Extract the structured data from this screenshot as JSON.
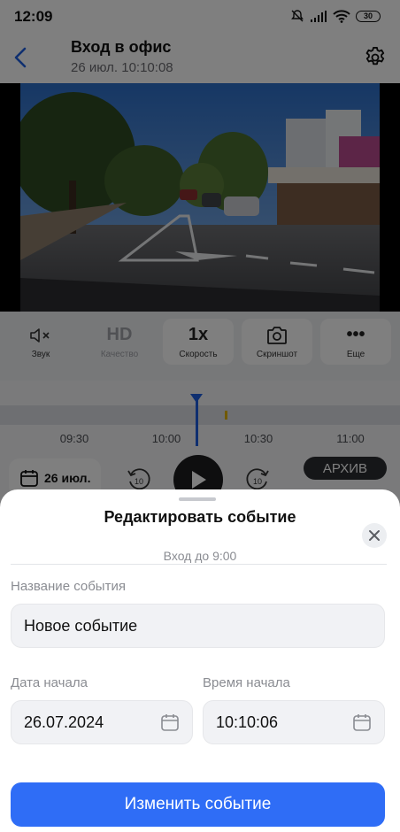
{
  "status_bar": {
    "time": "12:09",
    "battery": "30"
  },
  "header": {
    "title": "Вход в офис",
    "subtitle": "26 июл. 10:10:08"
  },
  "controls": [
    {
      "label": "Звук",
      "icon": "speaker-muted-icon"
    },
    {
      "label": "Качество",
      "icon_text": "HD"
    },
    {
      "label": "Скорость",
      "icon_text": "1x"
    },
    {
      "label": "Скриншот",
      "icon": "camera-icon"
    },
    {
      "label": "Еще",
      "icon_text": "•••"
    }
  ],
  "timeline": {
    "ticks": [
      "09:30",
      "10:00",
      "10:30",
      "11:00"
    ],
    "date_chip": "26 июл.",
    "skip_seconds": "10",
    "mode_badge": "АРХИВ"
  },
  "sheet": {
    "title": "Редактировать событие",
    "subtitle": "Вход до 9:00",
    "event_name_label": "Название события",
    "event_name_value": "Новое событие",
    "start_date_label": "Дата начала",
    "start_date_value": "26.07.2024",
    "start_time_label": "Время начала",
    "start_time_value": "10:10:06",
    "submit_label": "Изменить событие"
  },
  "colors": {
    "accent": "#2f6df6",
    "marker": "#1f5fe0",
    "event": "#e3b400"
  }
}
